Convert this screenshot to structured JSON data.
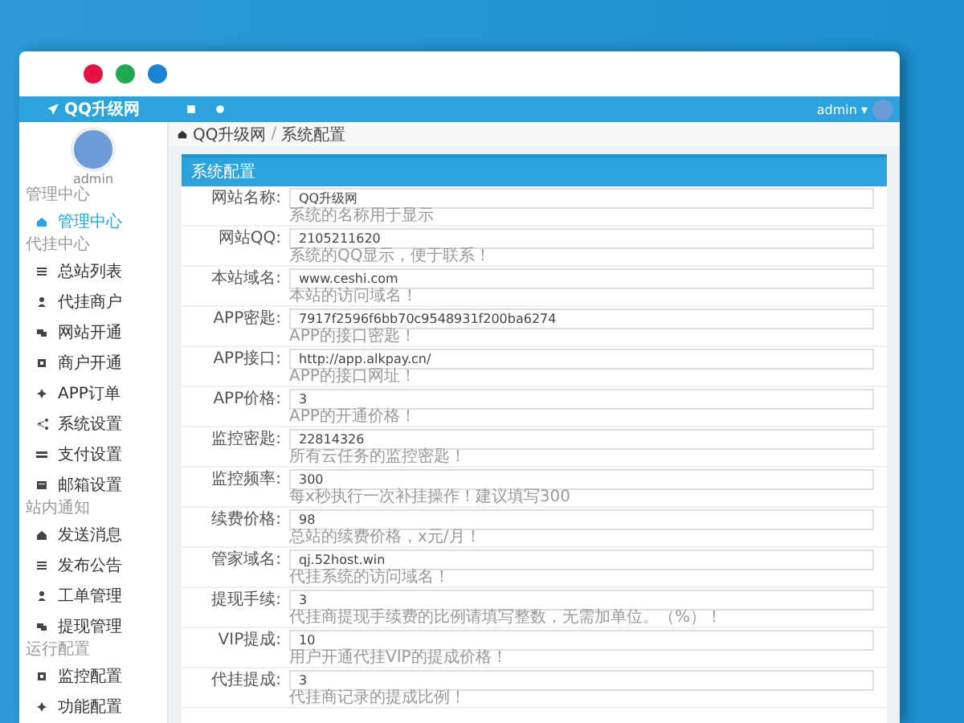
{
  "app": {
    "logo": "QQ升级网",
    "user": "admin ▾"
  },
  "sidebar": {
    "user": "admin",
    "sections": [
      {
        "title": "管理中心",
        "items": [
          {
            "label": "管理中心",
            "selected": true
          }
        ]
      },
      {
        "title": "代挂中心",
        "items": [
          {
            "label": "总站列表",
            "selected": false
          },
          {
            "label": "代挂商户",
            "selected": false
          },
          {
            "label": "网站开通",
            "selected": false
          },
          {
            "label": "商户开通",
            "selected": false
          },
          {
            "label": "APP订单",
            "selected": false
          },
          {
            "label": "系统设置",
            "selected": false
          },
          {
            "label": "支付设置",
            "selected": false
          },
          {
            "label": "邮箱设置",
            "selected": false
          }
        ]
      },
      {
        "title": "站内通知",
        "items": [
          {
            "label": "发送消息",
            "selected": false
          },
          {
            "label": "发布公告",
            "selected": false
          },
          {
            "label": "工单管理",
            "selected": false
          },
          {
            "label": "提现管理",
            "selected": false
          }
        ]
      },
      {
        "title": "运行配置",
        "items": [
          {
            "label": "监控配置",
            "selected": false
          },
          {
            "label": "功能配置",
            "selected": false
          }
        ]
      }
    ]
  },
  "breadcrumb": [
    "QQ升级网",
    "系统配置"
  ],
  "breadcrumb_separator": "/",
  "panel": {
    "title": "系统配置",
    "fields": [
      {
        "label": "网站名称:",
        "value": "QQ升级网",
        "hint": "系统的名称用于显示"
      },
      {
        "label": "网站QQ:",
        "value": "2105211620",
        "hint": "系统的QQ显示，便于联系！"
      },
      {
        "label": "本站域名:",
        "value": "www.ceshi.com",
        "hint": "本站的访问域名！"
      },
      {
        "label": "APP密匙:",
        "value": "7917f2596f6bb70c9548931f200ba6274",
        "hint": "APP的接口密匙！"
      },
      {
        "label": "APP接口:",
        "value": "http://app.alkpay.cn/",
        "hint": "APP的接口网址！"
      },
      {
        "label": "APP价格:",
        "value": "3",
        "hint": "APP的开通价格！"
      },
      {
        "label": "监控密匙:",
        "value": "22814326",
        "hint": "所有云任务的监控密匙！"
      },
      {
        "label": "监控频率:",
        "value": "300",
        "hint": "每x秒执行一次补挂操作！建议填写300"
      },
      {
        "label": "续费价格:",
        "value": "98",
        "hint": "总站的续费价格，x元/月！"
      },
      {
        "label": "管家域名:",
        "value": "qj.52host.win",
        "hint": "代挂系统的访问域名！"
      },
      {
        "label": "提现手续:",
        "value": "3",
        "hint": "代挂商提现手续费的比例请填写整数，无需加单位。（%）！"
      },
      {
        "label": "VIP提成:",
        "value": "10",
        "hint": "用户开通代挂VIP的提成价格！"
      },
      {
        "label": "代挂提成:",
        "value": "3",
        "hint": "代挂商记录的提成比例！"
      }
    ]
  }
}
